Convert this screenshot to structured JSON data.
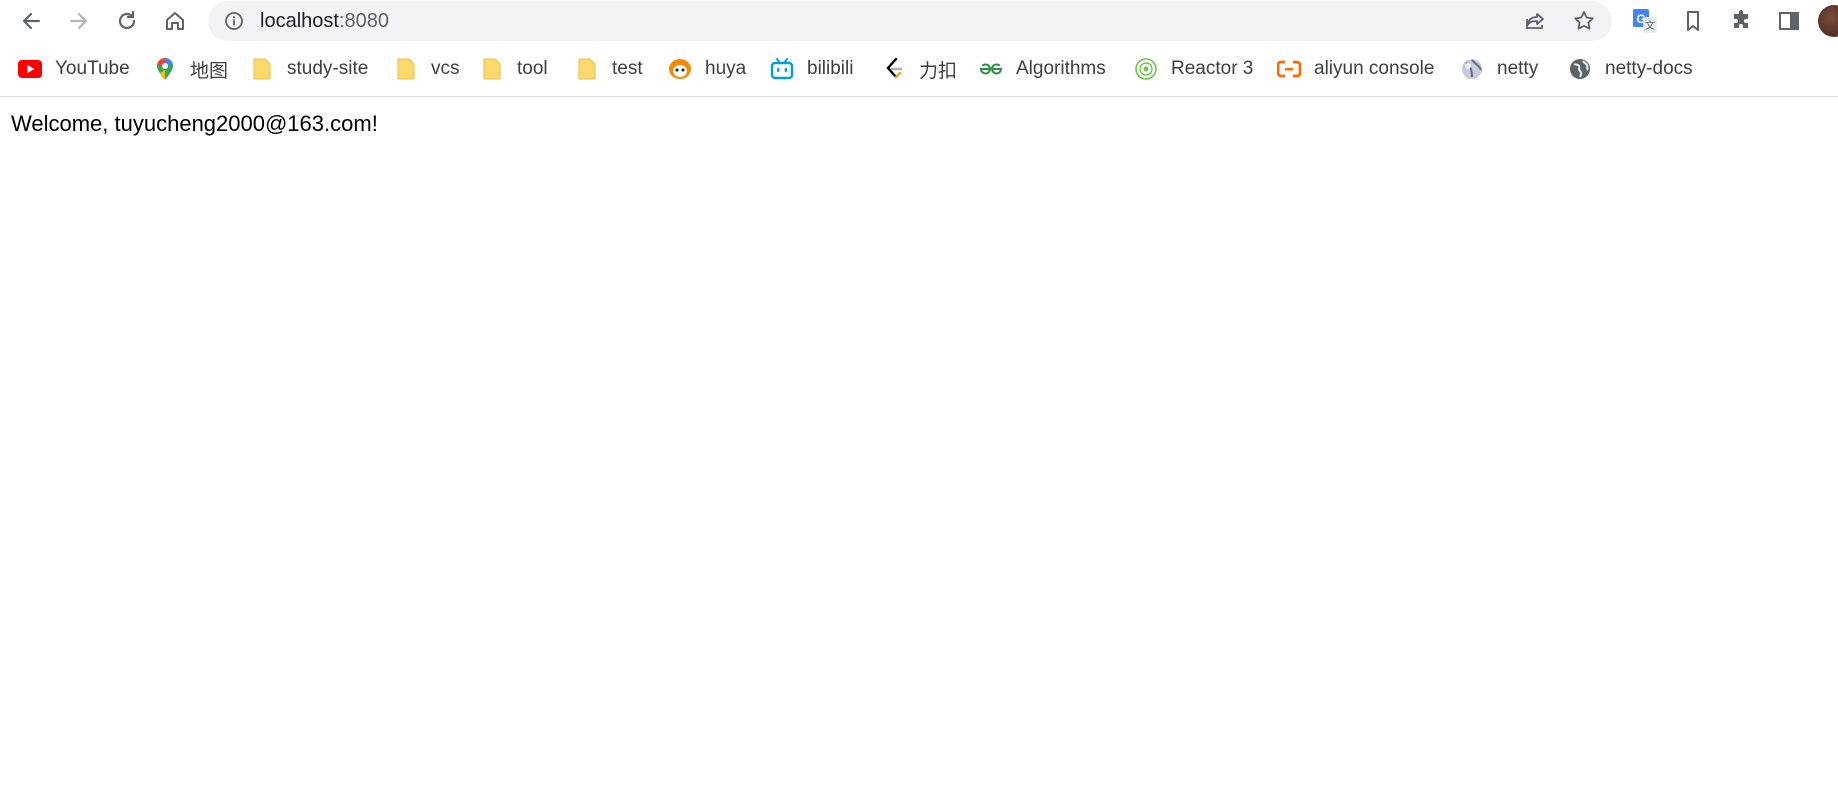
{
  "toolbar": {
    "url_host": "localhost",
    "url_port": ":8080"
  },
  "bookmarks": [
    {
      "label": "YouTube",
      "icon": "youtube-icon"
    },
    {
      "label": "地图",
      "icon": "maps-pin-icon"
    },
    {
      "label": "study-site",
      "icon": "folder-icon"
    },
    {
      "label": "vcs",
      "icon": "folder-icon"
    },
    {
      "label": "tool",
      "icon": "folder-icon"
    },
    {
      "label": "test",
      "icon": "folder-icon"
    },
    {
      "label": "huya",
      "icon": "huya-icon"
    },
    {
      "label": "bilibili",
      "icon": "bilibili-icon"
    },
    {
      "label": "力扣",
      "icon": "leetcode-icon"
    },
    {
      "label": "Algorithms",
      "icon": "geeksforgeeks-icon"
    },
    {
      "label": "Reactor 3",
      "icon": "reactor-icon"
    },
    {
      "label": "aliyun console",
      "icon": "aliyun-icon"
    },
    {
      "label": "netty",
      "icon": "netty-icon"
    },
    {
      "label": "netty-docs",
      "icon": "globe-icon"
    }
  ],
  "page": {
    "welcome_text": "Welcome, tuyucheng2000@163.com!"
  },
  "colors": {
    "omnibox_bg": "#f1f3f4",
    "folder": "#fbd96c",
    "youtube_red": "#ff0000",
    "bilibili_blue": "#00a1d6",
    "aliyun_orange": "#ff6a00",
    "gfg_green": "#2f8d46"
  }
}
